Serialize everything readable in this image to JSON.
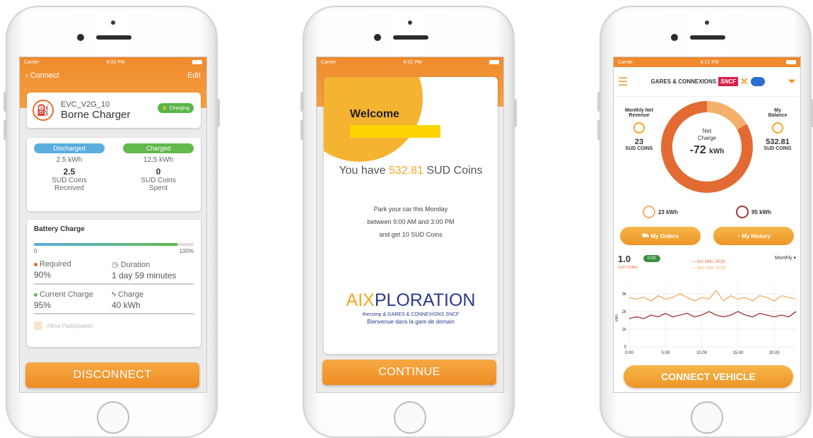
{
  "status": {
    "carrier": "Carrier",
    "time1": "6:02 PM",
    "time2": "6:02 PM",
    "time3": "6:12 PM"
  },
  "phone1": {
    "nav_back": "‹ Connect",
    "nav_edit": "Edit",
    "charger_id": "EVC_V2G_10",
    "charger_name": "Borne Charger",
    "charging_badge": "Charging",
    "discharged_label": "Discharged",
    "discharged_kwh": "2.5 kWh",
    "received_value": "2.5",
    "received_label_1": "SUD Coins",
    "received_label_2": "Received",
    "charged_label": "Charged",
    "charged_kwh": "12.5 kWh",
    "spent_value": "0",
    "spent_label_1": "SUD Coins",
    "spent_label_2": "Spent",
    "battery_title": "Battery Charge",
    "battery_progress": 0.9,
    "prog_min": "0",
    "prog_max": "100%",
    "required_label": "Required",
    "required_value": "90%",
    "duration_label": "Duration",
    "duration_value": "1 day 59 minutes",
    "current_label": "Current Charge",
    "current_value": "95%",
    "charge_label": "Charge",
    "charge_value": "40 kWh",
    "allow_label": "Allow Participation",
    "disconnect": "DISCONNECT",
    "colors": {
      "accent": "#f08a2c",
      "blue": "#5aaede",
      "green": "#62b94c"
    }
  },
  "phone2": {
    "welcome": "Welcome",
    "coins_prefix": "You have ",
    "coins_amount": "532.81",
    "coins_suffix": " SUD Coins",
    "park_1": "Park your car this Monday",
    "park_2": "between 9:00 AM and 3:00 PM",
    "park_3": "and get 10 SUD Coins",
    "logo_a": "AIX",
    "logo_b": "PLORATION",
    "partners": "thecomp & GARES & CONNEXIONS SNCF",
    "tagline": "Bienvenue dans la gare de demain",
    "continue": "CONTINUE"
  },
  "phone3": {
    "brand_text": "GARES & CONNEXIONS",
    "brand_sncf": "SNCF",
    "monthly_label_1": "Monthly Net",
    "monthly_label_2": "Revenue",
    "monthly_value": "23",
    "monthly_unit": "SUD COINS",
    "balance_label_1": "My",
    "balance_label_2": "Balance",
    "balance_value": "532.81",
    "balance_unit": "SUD COINS",
    "net_label_1": "Net",
    "net_label_2": "Charge",
    "net_value": "-72",
    "net_unit": "kWh",
    "net_ratio": 0.167,
    "kwh_a": "23 kWh",
    "kwh_b": "95 kWh",
    "my_orders": "My Orders",
    "my_history": "My History",
    "chart_value": "1.0",
    "chart_unit": "SUD COINS",
    "green_badge": "0.00",
    "legend_1": "— Oct 26th, 2019",
    "legend_2": "— Nov 25th, 2019",
    "period": "Monthly ▾",
    "connect": "CONNECT VEHICLE"
  },
  "chart_data": {
    "type": "line",
    "x": [
      0,
      1,
      2,
      3,
      4,
      5,
      6,
      7,
      8,
      9,
      10,
      11,
      12,
      13,
      14,
      15,
      16,
      17,
      18,
      19,
      20,
      21,
      22,
      23
    ],
    "series": [
      {
        "name": "Oct 26th, 2019",
        "values": [
          1.6,
          1.7,
          1.6,
          1.8,
          1.7,
          1.9,
          1.7,
          1.8,
          1.9,
          1.7,
          1.8,
          2.0,
          1.8,
          1.7,
          1.8,
          2.0,
          1.8,
          1.7,
          1.9,
          1.8,
          1.7,
          1.8,
          1.7,
          2.0
        ]
      },
      {
        "name": "Nov 25th, 2019",
        "values": [
          2.8,
          2.7,
          2.8,
          2.6,
          2.9,
          2.7,
          2.8,
          3.0,
          2.8,
          2.6,
          2.8,
          2.7,
          3.2,
          2.6,
          2.9,
          2.7,
          2.8,
          2.6,
          2.9,
          2.8,
          2.6,
          2.9,
          2.8,
          2.7
        ]
      }
    ],
    "x_ticks": [
      "0.00",
      "5.00",
      "10.00",
      "15.00",
      "20.00"
    ],
    "y_ticks": [
      "0",
      "1k",
      "2k",
      "3k"
    ],
    "ylabel": "kWh",
    "ylim": [
      0,
      3.6
    ],
    "xlim": [
      0,
      23
    ],
    "colors": [
      "#a23a3a",
      "#f3b06a"
    ]
  }
}
